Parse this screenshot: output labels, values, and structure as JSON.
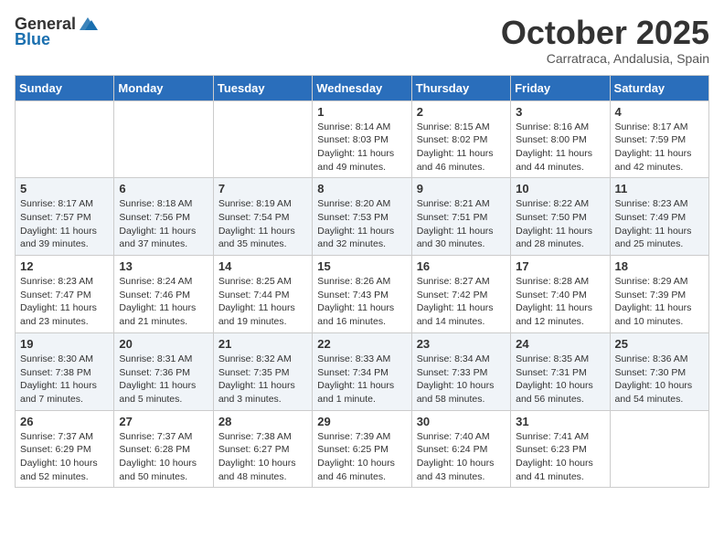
{
  "header": {
    "logo_line1": "General",
    "logo_line2": "Blue",
    "month": "October 2025",
    "location": "Carratraca, Andalusia, Spain"
  },
  "weekdays": [
    "Sunday",
    "Monday",
    "Tuesday",
    "Wednesday",
    "Thursday",
    "Friday",
    "Saturday"
  ],
  "weeks": [
    [
      {
        "day": "",
        "info": ""
      },
      {
        "day": "",
        "info": ""
      },
      {
        "day": "",
        "info": ""
      },
      {
        "day": "1",
        "info": "Sunrise: 8:14 AM\nSunset: 8:03 PM\nDaylight: 11 hours\nand 49 minutes."
      },
      {
        "day": "2",
        "info": "Sunrise: 8:15 AM\nSunset: 8:02 PM\nDaylight: 11 hours\nand 46 minutes."
      },
      {
        "day": "3",
        "info": "Sunrise: 8:16 AM\nSunset: 8:00 PM\nDaylight: 11 hours\nand 44 minutes."
      },
      {
        "day": "4",
        "info": "Sunrise: 8:17 AM\nSunset: 7:59 PM\nDaylight: 11 hours\nand 42 minutes."
      }
    ],
    [
      {
        "day": "5",
        "info": "Sunrise: 8:17 AM\nSunset: 7:57 PM\nDaylight: 11 hours\nand 39 minutes."
      },
      {
        "day": "6",
        "info": "Sunrise: 8:18 AM\nSunset: 7:56 PM\nDaylight: 11 hours\nand 37 minutes."
      },
      {
        "day": "7",
        "info": "Sunrise: 8:19 AM\nSunset: 7:54 PM\nDaylight: 11 hours\nand 35 minutes."
      },
      {
        "day": "8",
        "info": "Sunrise: 8:20 AM\nSunset: 7:53 PM\nDaylight: 11 hours\nand 32 minutes."
      },
      {
        "day": "9",
        "info": "Sunrise: 8:21 AM\nSunset: 7:51 PM\nDaylight: 11 hours\nand 30 minutes."
      },
      {
        "day": "10",
        "info": "Sunrise: 8:22 AM\nSunset: 7:50 PM\nDaylight: 11 hours\nand 28 minutes."
      },
      {
        "day": "11",
        "info": "Sunrise: 8:23 AM\nSunset: 7:49 PM\nDaylight: 11 hours\nand 25 minutes."
      }
    ],
    [
      {
        "day": "12",
        "info": "Sunrise: 8:23 AM\nSunset: 7:47 PM\nDaylight: 11 hours\nand 23 minutes."
      },
      {
        "day": "13",
        "info": "Sunrise: 8:24 AM\nSunset: 7:46 PM\nDaylight: 11 hours\nand 21 minutes."
      },
      {
        "day": "14",
        "info": "Sunrise: 8:25 AM\nSunset: 7:44 PM\nDaylight: 11 hours\nand 19 minutes."
      },
      {
        "day": "15",
        "info": "Sunrise: 8:26 AM\nSunset: 7:43 PM\nDaylight: 11 hours\nand 16 minutes."
      },
      {
        "day": "16",
        "info": "Sunrise: 8:27 AM\nSunset: 7:42 PM\nDaylight: 11 hours\nand 14 minutes."
      },
      {
        "day": "17",
        "info": "Sunrise: 8:28 AM\nSunset: 7:40 PM\nDaylight: 11 hours\nand 12 minutes."
      },
      {
        "day": "18",
        "info": "Sunrise: 8:29 AM\nSunset: 7:39 PM\nDaylight: 11 hours\nand 10 minutes."
      }
    ],
    [
      {
        "day": "19",
        "info": "Sunrise: 8:30 AM\nSunset: 7:38 PM\nDaylight: 11 hours\nand 7 minutes."
      },
      {
        "day": "20",
        "info": "Sunrise: 8:31 AM\nSunset: 7:36 PM\nDaylight: 11 hours\nand 5 minutes."
      },
      {
        "day": "21",
        "info": "Sunrise: 8:32 AM\nSunset: 7:35 PM\nDaylight: 11 hours\nand 3 minutes."
      },
      {
        "day": "22",
        "info": "Sunrise: 8:33 AM\nSunset: 7:34 PM\nDaylight: 11 hours\nand 1 minute."
      },
      {
        "day": "23",
        "info": "Sunrise: 8:34 AM\nSunset: 7:33 PM\nDaylight: 10 hours\nand 58 minutes."
      },
      {
        "day": "24",
        "info": "Sunrise: 8:35 AM\nSunset: 7:31 PM\nDaylight: 10 hours\nand 56 minutes."
      },
      {
        "day": "25",
        "info": "Sunrise: 8:36 AM\nSunset: 7:30 PM\nDaylight: 10 hours\nand 54 minutes."
      }
    ],
    [
      {
        "day": "26",
        "info": "Sunrise: 7:37 AM\nSunset: 6:29 PM\nDaylight: 10 hours\nand 52 minutes."
      },
      {
        "day": "27",
        "info": "Sunrise: 7:37 AM\nSunset: 6:28 PM\nDaylight: 10 hours\nand 50 minutes."
      },
      {
        "day": "28",
        "info": "Sunrise: 7:38 AM\nSunset: 6:27 PM\nDaylight: 10 hours\nand 48 minutes."
      },
      {
        "day": "29",
        "info": "Sunrise: 7:39 AM\nSunset: 6:25 PM\nDaylight: 10 hours\nand 46 minutes."
      },
      {
        "day": "30",
        "info": "Sunrise: 7:40 AM\nSunset: 6:24 PM\nDaylight: 10 hours\nand 43 minutes."
      },
      {
        "day": "31",
        "info": "Sunrise: 7:41 AM\nSunset: 6:23 PM\nDaylight: 10 hours\nand 41 minutes."
      },
      {
        "day": "",
        "info": ""
      }
    ]
  ]
}
